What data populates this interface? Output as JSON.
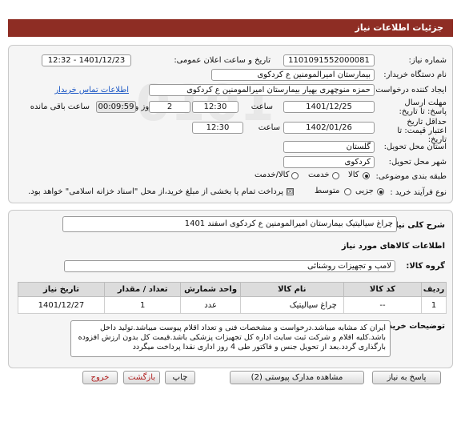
{
  "header": {
    "title": "جزئیات اطلاعات نیاز"
  },
  "watermark": {
    "brand": "ParsNamadata",
    "phone": "۰۲۱-۸۸۳۴۹۶۷۰",
    "tagline": "مرکز فراخوان اطلاع رسانی مناقصات و مزایدات"
  },
  "form": {
    "need_number_label": "شماره نیاز:",
    "need_number": "1101091552000081",
    "announce_label": "تاریخ و ساعت اعلان عمومی:",
    "announce_value": "1401/12/23 - 12:32",
    "buyer_label": "نام دستگاه خریدار:",
    "buyer": "بیمارستان امیرالمومنین  ع  کردکوی",
    "creator_label": "ایجاد کننده درخواست:",
    "creator": "حمزه  منوچهری بهیار بیمارستان امیرالمومنین  ع  کردکوی",
    "contact_link": "اطلاعات تماس خریدار",
    "deadline_label": "مهلت ارسال پاسخ: تا تاریخ:",
    "deadline_date": "1401/12/25",
    "time_label": "ساعت",
    "deadline_time": "12:30",
    "day_label": "روز و",
    "days": "2",
    "remaining": "00:09:59",
    "remaining_label": "ساعت باقی مانده",
    "validity_label": "حداقل تاریخ اعتبار قیمت: تا تاریخ:",
    "validity_date": "1402/01/26",
    "validity_time": "12:30",
    "province_label": "استان محل تحویل:",
    "province": "گلستان",
    "city_label": "شهر محل تحویل:",
    "city": "کردکوی",
    "category_label": "طبقه بندی موضوعی:",
    "category_options": [
      "کالا",
      "خدمت",
      "کالا/خدمت"
    ],
    "process_label": "نوع فرآیند خرید :",
    "process_options": [
      "جزیی",
      "متوسط"
    ],
    "payment_note": "پرداخت تمام یا بخشی از مبلغ خرید،از محل \"اسناد خزانه اسلامی\" خواهد بود."
  },
  "summary": {
    "label": "شرح کلی نیاز:",
    "value": "چراغ سیالیتیک بیمارستان امیرالمومنین ع کردکوی اسفند 1401"
  },
  "goods": {
    "section_title": "اطلاعات کالاهای مورد نیاز",
    "group_label": "گروه کالا:",
    "group_value": "لامپ و تجهیزات روشنائی",
    "columns": {
      "row": "ردیف",
      "code": "کد کالا",
      "name": "نام کالا",
      "unit": "واحد شمارش",
      "qty": "تعداد / مقدار",
      "date": "تاریخ نیاز"
    },
    "rows": [
      {
        "row": "1",
        "code": "--",
        "name": "چراغ سیالیتیک",
        "unit": "عدد",
        "qty": "1",
        "date": "1401/12/27"
      }
    ]
  },
  "notes": {
    "label": "توضیحات خریدار:",
    "text": "ایران کد مشابه میباشد.درخواست و مشخصات فنی و تعداد اقلام پیوست میباشد.تولید داخل باشد.کلیه اقلام و شرکت ثبت سایت اداره کل تجهیزات پزشکی باشد.قیمت کل بدون ارزش افزوده بارگذاری گردد.بعد از تحویل جنس و فاکتور طی 4 روز اداری نقدا پرداخت میگردد"
  },
  "buttons": {
    "reply": "پاسخ به نیاز",
    "attachments": "مشاهده مدارک پیوستی (2)",
    "print": "چاپ",
    "back": "بازگشت",
    "exit": "خروج"
  }
}
